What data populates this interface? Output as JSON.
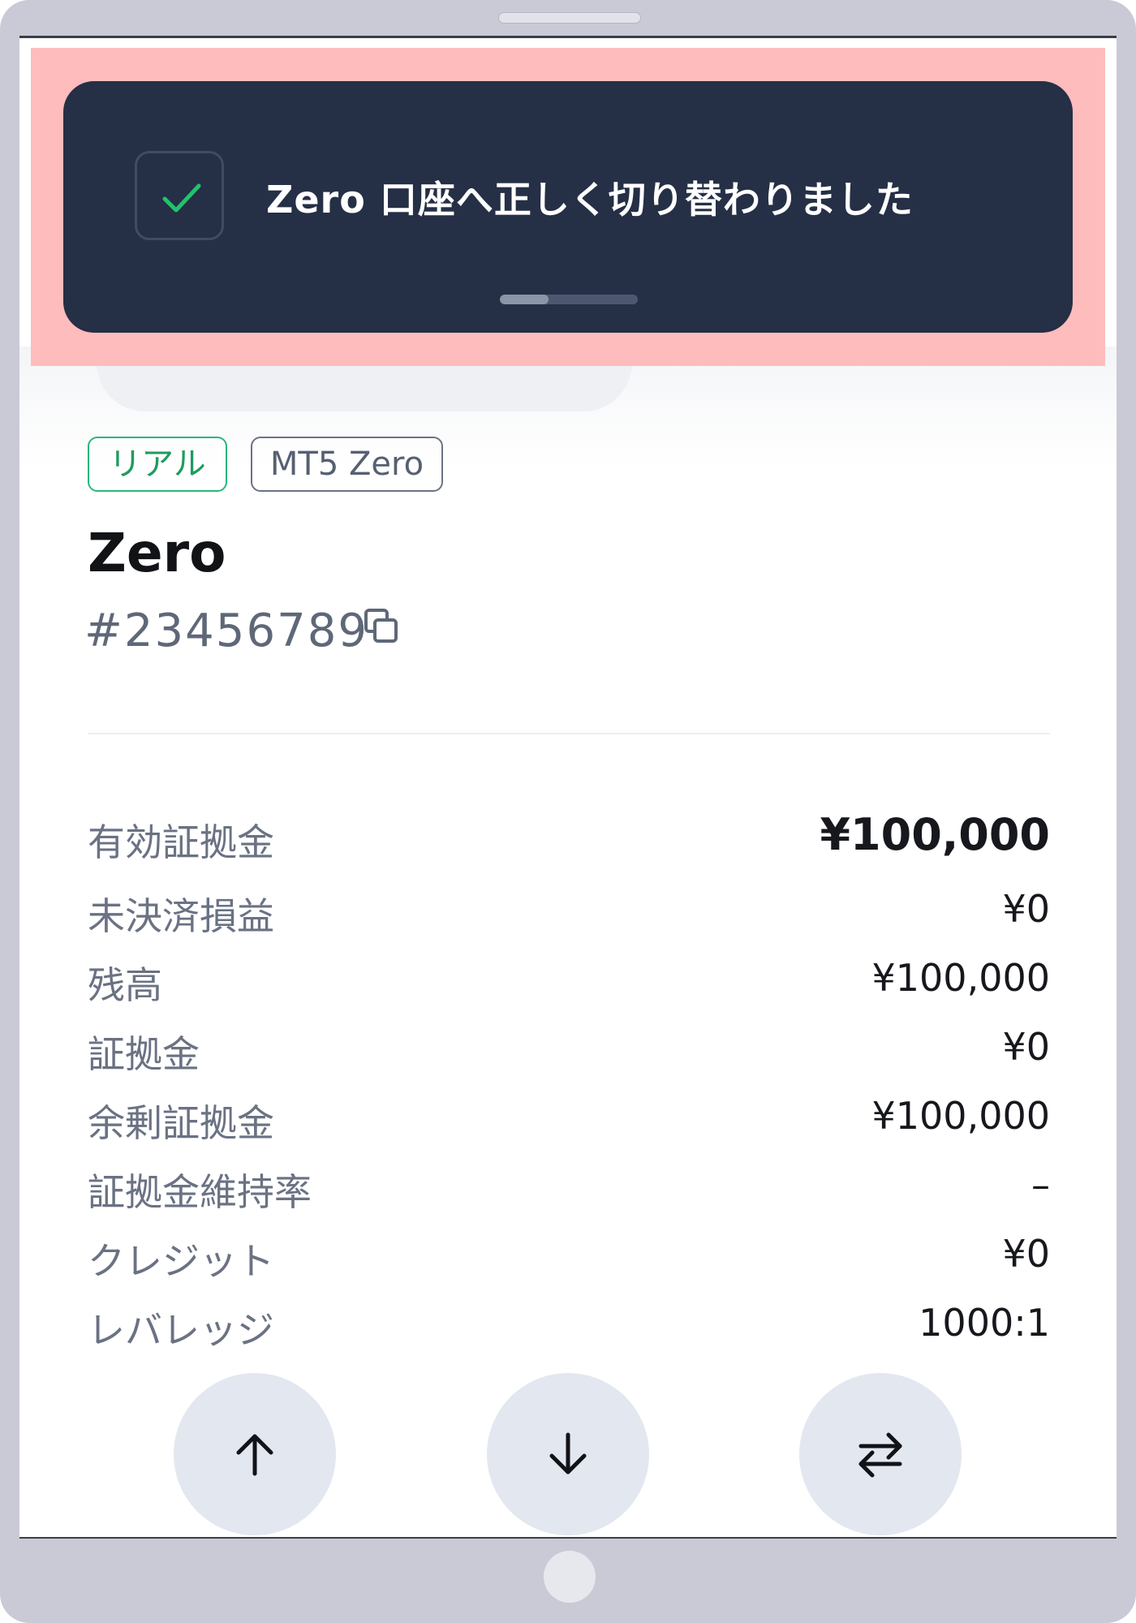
{
  "toast": {
    "message": "Zero 口座へ正しく切り替わりました",
    "icon": "check-icon",
    "progress_fraction": 0.35,
    "check_color": "#22c26b"
  },
  "account": {
    "tag_real": "リアル",
    "tag_type": "MT5 Zero",
    "name": "Zero",
    "number": "#23456789"
  },
  "stats": [
    {
      "label": "有効証拠金",
      "value": "¥100,000"
    },
    {
      "label": "未決済損益",
      "value": "¥0"
    },
    {
      "label": "残高",
      "value": "¥100,000"
    },
    {
      "label": "証拠金",
      "value": "¥0"
    },
    {
      "label": "余剰証拠金",
      "value": "¥100,000"
    },
    {
      "label": "証拠金維持率",
      "value": "–"
    },
    {
      "label": "クレジット",
      "value": "¥0"
    },
    {
      "label": "レバレッジ",
      "value": "1000:1"
    }
  ],
  "actions": [
    {
      "icon": "arrow-up-icon"
    },
    {
      "icon": "arrow-down-icon"
    },
    {
      "icon": "transfer-icon"
    }
  ]
}
